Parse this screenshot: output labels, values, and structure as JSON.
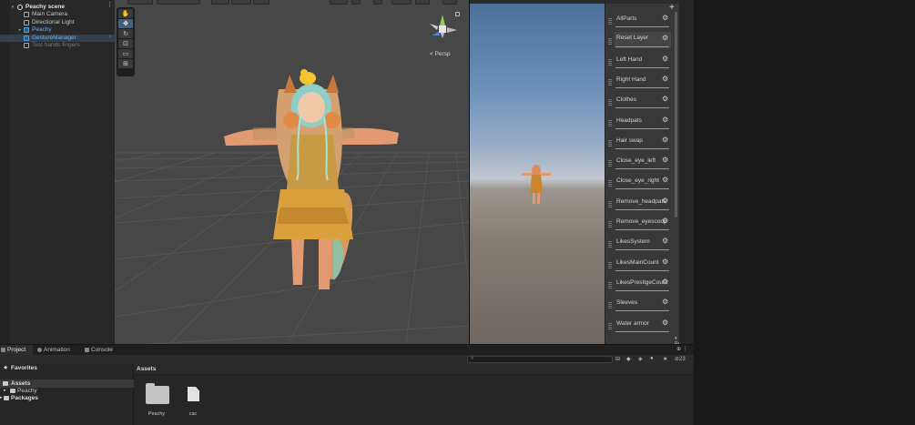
{
  "hierarchy": {
    "items": [
      {
        "label": "Peachy scene",
        "type": "scene",
        "indent": 0
      },
      {
        "label": "Main Camera",
        "type": "object",
        "indent": 1
      },
      {
        "label": "Directional Light",
        "type": "object",
        "indent": 1
      },
      {
        "label": "Peachy",
        "type": "prefab",
        "indent": 1
      },
      {
        "label": "GestureManager",
        "type": "prefab",
        "indent": 1
      },
      {
        "label": "Test hands fingers",
        "type": "disabled",
        "indent": 1
      }
    ]
  },
  "scene_view": {
    "projection_label": "< Persp",
    "tools": [
      "hand-tool",
      "move-tool",
      "rotate-tool",
      "scale-tool",
      "rect-tool",
      "transform-tool"
    ]
  },
  "expressions": {
    "items": [
      "AllParts",
      "Reset Layer",
      "Left Hand",
      "Right Hand",
      "Clothes",
      "Headpats",
      "Hair swap",
      "Close_eye_left",
      "Close_eye_right",
      "Remove_headpats",
      "Remove_eyescoop",
      "LikesSystem",
      "LikesMainCount",
      "LikesPrestigeCount",
      "Sleeves",
      "Water armor"
    ],
    "add_label": "+",
    "footer": "▾ Reset"
  },
  "bottom": {
    "tabs": [
      {
        "label": "Project",
        "active": true
      },
      {
        "label": "Animation",
        "active": false
      },
      {
        "label": "Console",
        "active": false
      }
    ],
    "search_icon": "⌕",
    "count": "23",
    "tree": {
      "favorites": "Favorites",
      "assets": "Assets",
      "peachy": "Peachy",
      "packages": "Packages"
    },
    "assets_title": "Assets",
    "asset_items": [
      {
        "label": "Peachy",
        "kind": "folder"
      },
      {
        "label": "cac",
        "kind": "file"
      }
    ]
  },
  "colors": {
    "selection": "#34404e",
    "prefab_blue": "#6db1f2",
    "scene_bg": "#474747"
  }
}
